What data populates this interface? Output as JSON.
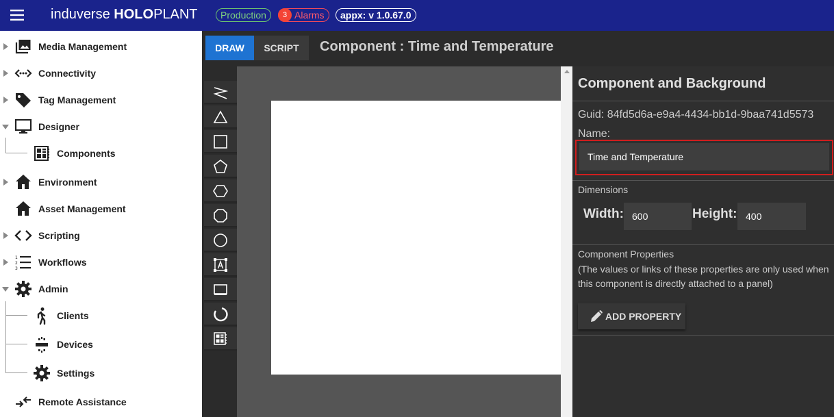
{
  "header": {
    "brand_light": "induverse ",
    "brand_bold": "HOLO",
    "brand_end": "PLANT",
    "env_badge": "Production",
    "alarm_count": "3",
    "alarm_label": "Alarms",
    "version": "appx: v 1.0.67.0"
  },
  "sidebar": {
    "items": [
      {
        "label": "Media Management",
        "icon": "image-icon"
      },
      {
        "label": "Connectivity",
        "icon": "connectivity-icon"
      },
      {
        "label": "Tag Management",
        "icon": "tag-icon"
      },
      {
        "label": "Designer",
        "icon": "monitor-icon"
      },
      {
        "label": "Components",
        "icon": "component-icon"
      },
      {
        "label": "Environment",
        "icon": "home-icon"
      },
      {
        "label": "Asset Management",
        "icon": "home-icon"
      },
      {
        "label": "Scripting",
        "icon": "code-icon"
      },
      {
        "label": "Workflows",
        "icon": "list-icon"
      },
      {
        "label": "Admin",
        "icon": "gear-icon"
      },
      {
        "label": "Clients",
        "icon": "walk-icon"
      },
      {
        "label": "Devices",
        "icon": "device-icon"
      },
      {
        "label": "Settings",
        "icon": "gear-icon"
      },
      {
        "label": "Remote Assistance",
        "icon": "swap-icon"
      }
    ]
  },
  "editor": {
    "tabs": [
      {
        "label": "DRAW"
      },
      {
        "label": "SCRIPT"
      }
    ],
    "active_tab": "DRAW",
    "title": "Component : Time and Temperature",
    "tools": [
      "polyline-icon",
      "triangle-icon",
      "rectangle-icon",
      "pentagon-icon",
      "hexagon-icon",
      "octagon-icon",
      "circle-icon",
      "text-icon",
      "display-icon",
      "arc-icon",
      "component-icon"
    ]
  },
  "panel": {
    "title": "Component and Background",
    "guid": "Guid: 84fd5d6a-e9a4-4434-bb1d-9baa741d5573",
    "name_label": "Name:",
    "name_value": "Time and Temperature",
    "dimensions_label": "Dimensions",
    "width_label": "Width:",
    "width_value": "600",
    "height_label": "Height:",
    "height_value": "400",
    "properties_label": "Component Properties",
    "properties_desc": "(The values or links of these properties are only used when this component is directly attached to a panel)",
    "add_property_label": "ADD PROPERTY"
  },
  "colors": {
    "topbar": "#1a238c",
    "accent": "#1e73d2",
    "highlight": "#d11e1e",
    "production": "#6cc26f",
    "alarm": "#f44336"
  }
}
